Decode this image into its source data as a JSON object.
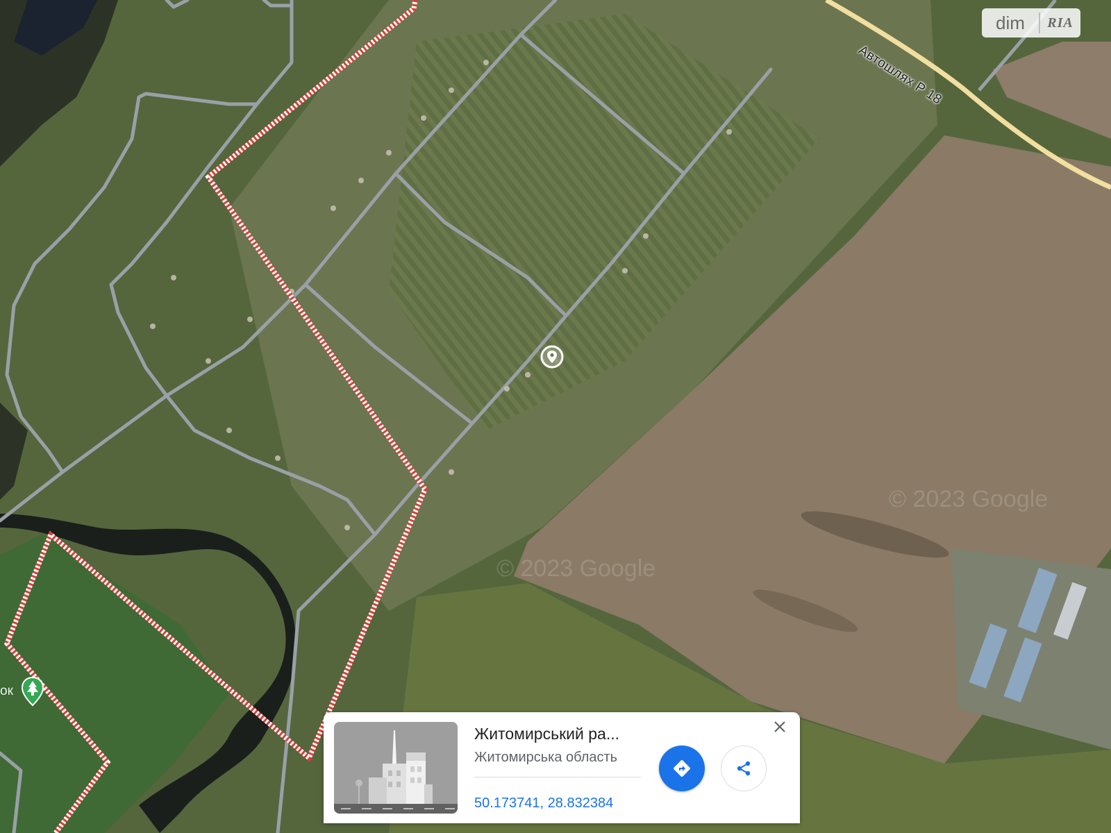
{
  "map": {
    "road_label": "Автошлях Р 18",
    "park_label": "ок",
    "watermarks": [
      "© 2023 Google",
      "© 2023 Google"
    ],
    "icons": {
      "location_pin": "map-pin-icon",
      "park_pin": "tree-icon"
    },
    "colors": {
      "boundary": "#e53935",
      "highway": "#f2dfa0",
      "road": "#9aa0a6"
    }
  },
  "logo": {
    "dim": "dim",
    "ria": "RIA"
  },
  "card": {
    "title": "Житомирський ра...",
    "subtitle": "Житомирська область",
    "coordinates": "50.173741, 28.832384",
    "icons": {
      "directions": "directions-icon",
      "share": "share-icon",
      "close": "close-icon"
    },
    "accent_color": "#1a73e8"
  }
}
